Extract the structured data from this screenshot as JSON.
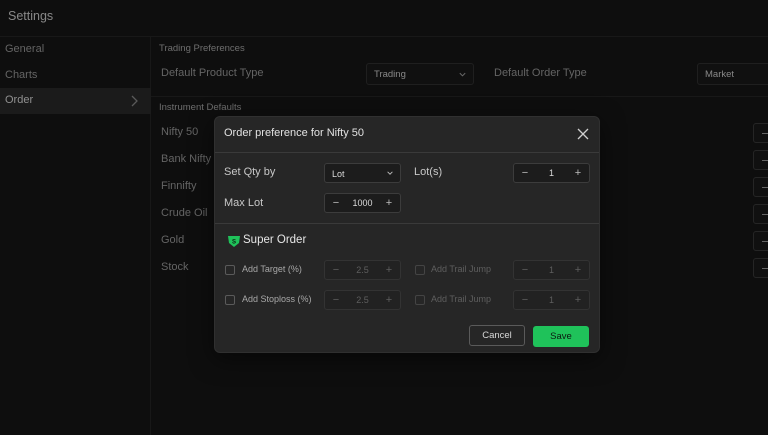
{
  "app": {
    "title": "Settings"
  },
  "sidebar": {
    "items": [
      {
        "label": "General"
      },
      {
        "label": "Charts"
      },
      {
        "label": "Order"
      }
    ]
  },
  "trading_preferences": {
    "section_label": "Trading Preferences",
    "product_type_label": "Default Product Type",
    "product_type_value": "Trading",
    "order_type_label": "Default Order Type",
    "order_type_value": "Market"
  },
  "instrument_defaults": {
    "section_label": "Instrument Defaults",
    "instruments": [
      "Nifty 50",
      "Bank Nifty",
      "Finnifty",
      "Crude Oil",
      "Gold",
      "Stock"
    ]
  },
  "modal": {
    "title": "Order preference for Nifty 50",
    "set_qty_label": "Set Qty by",
    "set_qty_value": "Lot",
    "lots_label": "Lot(s)",
    "lots_value": "1",
    "max_lot_label": "Max Lot",
    "max_lot_value": "1000",
    "super_order_title": "Super Order",
    "super_icon_letter": "S",
    "add_target_label": "Add Target (%)",
    "add_target_value": "2.5",
    "add_trail_jump_label_1": "Add Trail Jump",
    "trail_jump_value_1": "1",
    "add_stoploss_label": "Add Stoploss (%)",
    "add_stoploss_value": "2.5",
    "add_trail_jump_label_2": "Add Trail Jump",
    "trail_jump_value_2": "1",
    "minus": "−",
    "plus": "+",
    "cancel_label": "Cancel",
    "save_label": "Save"
  },
  "colors": {
    "accent": "#1fc25a",
    "background": "#161616",
    "modal_bg": "#262626"
  }
}
